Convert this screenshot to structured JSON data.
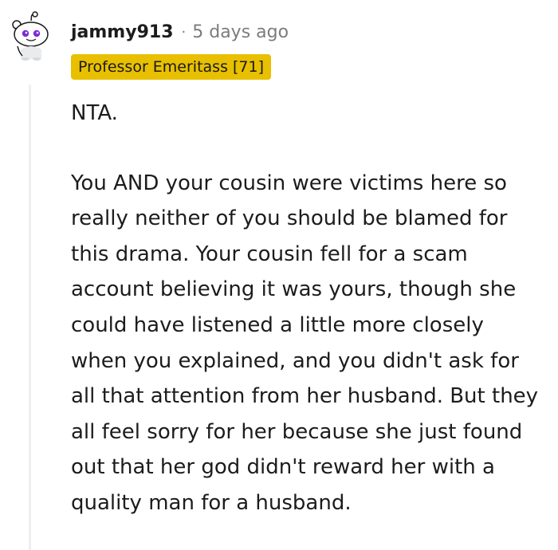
{
  "comment": {
    "username": "jammy913",
    "separator": "·",
    "timestamp": "5 days ago",
    "flair": "Professor Emeritass [71]",
    "paragraphs": [
      "NTA.",
      "You AND your cousin were victims here so really neither of you should be blamed for this drama. Your cousin fell for a scam account believing it was yours, though she could have listened a little more closely when you explained, and you didn't ask for all that attention from her husband. But they all feel sorry for her because she just found out that her god didn't reward her with a quality man for a husband."
    ],
    "avatar_icon": "snoo-avatar-icon",
    "colors": {
      "flair_background": "#e8c000",
      "avatar_eye": "#7b2cd6",
      "meta_gray": "#7c7c7c"
    }
  }
}
